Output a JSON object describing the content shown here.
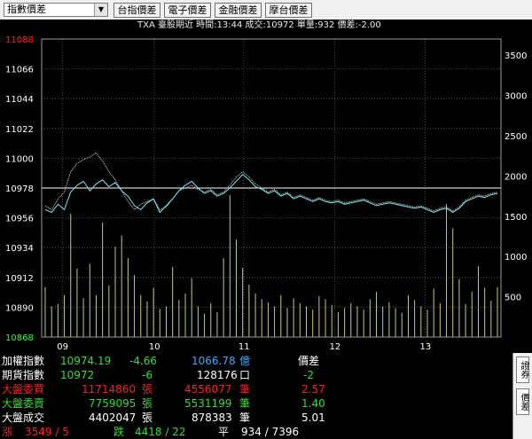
{
  "toolbar": {
    "selector": {
      "value": "指數價差"
    },
    "buttons": [
      {
        "label": "台指價差"
      },
      {
        "label": "電子價差"
      },
      {
        "label": "金融價差"
      },
      {
        "label": "摩台價差"
      }
    ]
  },
  "ticker": {
    "text": "TXA  臺股期近 時間:13:44 成交:10972 單量:932 價差:-2.00"
  },
  "colors": {
    "up": "#ff2020",
    "down": "#33dd33",
    "index_line": "#7fe5f0",
    "futures_line": "#dcdcdc",
    "volume": "#c8c880",
    "grid": "#4d4d4d",
    "axis_green": "#22ff22",
    "axis_red": "#ff2222",
    "ref_line": "#ffffff"
  },
  "chart_data": {
    "type": "line",
    "y_ticks": [
      "11088",
      "11066",
      "11044",
      "11022",
      "11000",
      "10978",
      "10956",
      "10934",
      "10912",
      "10890",
      "10868"
    ],
    "ylim": [
      10868,
      11088
    ],
    "reference_price": 10978,
    "right_ticks": [
      "3500",
      "3000",
      "2500",
      "2000",
      "1500",
      "1000",
      "500"
    ],
    "right_lim": [
      0,
      3700
    ],
    "x_ticks": [
      "09",
      "10",
      "11",
      "12",
      "13"
    ],
    "series": [
      {
        "values": [
          10962,
          10960,
          10966,
          10962,
          10975,
          10980,
          10983,
          10976,
          10981,
          10984,
          10979,
          10982,
          10976,
          10972,
          10965,
          10962,
          10967,
          10970,
          10960,
          10965,
          10970,
          10976,
          10980,
          10983,
          10978,
          10974,
          10976,
          10972,
          10974,
          10978,
          10983,
          10988,
          10984,
          10979,
          10977,
          10974,
          10976,
          10972,
          10974,
          10970,
          10972,
          10970,
          10968,
          10970,
          10968,
          10967,
          10968,
          10966,
          10967,
          10968,
          10969,
          10967,
          10965,
          10966,
          10967,
          10966,
          10965,
          10964,
          10963,
          10964,
          10962,
          10960,
          10962,
          10963,
          10960,
          10963,
          10968,
          10970,
          10972,
          10971,
          10973,
          10974
        ]
      },
      {
        "values": [
          10965,
          10962,
          10970,
          10975,
          10990,
          10996,
          10999,
          11001,
          11004,
          10998,
          10990,
          10984,
          10976,
          10968,
          10962,
          10966,
          10968,
          10970,
          10962,
          10964,
          10970,
          10976,
          10978,
          10980,
          10977,
          10975,
          10977,
          10973,
          10975,
          10980,
          10986,
          10990,
          10986,
          10981,
          10978,
          10975,
          10977,
          10973,
          10975,
          10971,
          10973,
          10971,
          10969,
          10971,
          10969,
          10968,
          10969,
          10967,
          10968,
          10969,
          10970,
          10968,
          10966,
          10967,
          10968,
          10967,
          10966,
          10965,
          10964,
          10965,
          10963,
          10961,
          10963,
          10964,
          10961,
          10964,
          10969,
          10971,
          10973,
          10972,
          10974,
          10975
        ]
      }
    ],
    "volume": [
      620,
      380,
      410,
      520,
      1530,
      850,
      480,
      910,
      520,
      1420,
      640,
      1120,
      1260,
      980,
      770,
      520,
      440,
      610,
      350,
      380,
      870,
      460,
      540,
      730,
      380,
      290,
      420,
      310,
      980,
      1760,
      1210,
      860,
      650,
      540,
      470,
      430,
      380,
      520,
      360,
      480,
      420,
      380,
      340,
      510,
      470,
      400,
      310,
      360,
      420,
      380,
      340,
      470,
      560,
      380,
      430,
      360,
      300,
      520,
      460,
      380,
      340,
      600,
      420,
      1650,
      1350,
      720,
      410,
      560,
      880,
      610,
      450,
      620
    ]
  },
  "quotes": {
    "row1": {
      "label": "加權指數",
      "price": "10974.19",
      "change": "-4.66",
      "amount": "1066.78",
      "unit": "億",
      "spread_label": "價差"
    },
    "row2": {
      "label": "期貨指數",
      "price": "10972",
      "change": "-6",
      "amount": "128176",
      "unit": "口",
      "spread": "-2"
    },
    "row3": {
      "label": "大盤委買",
      "qty": "11714860",
      "unit1": "張",
      "orders": "4556077",
      "unit2": "筆",
      "ratio": "2.57"
    },
    "row4": {
      "label": "大盤委賣",
      "qty": "7759095",
      "unit1": "張",
      "orders": "5531199",
      "unit2": "筆",
      "ratio": "1.40"
    },
    "row5": {
      "label": "大盤成交",
      "qty": "4402047",
      "unit1": "張",
      "orders": "878383",
      "unit2": "筆",
      "ratio": "5.01"
    },
    "row6": {
      "up_label": "漲",
      "up_value": "3549 / 5",
      "down_label": "跌",
      "down_value": "4418 / 22",
      "flat_label": "平",
      "flat_value": "934 / 7396"
    }
  },
  "side_tabs": [
    {
      "label": "證券"
    },
    {
      "label": "價差"
    }
  ]
}
